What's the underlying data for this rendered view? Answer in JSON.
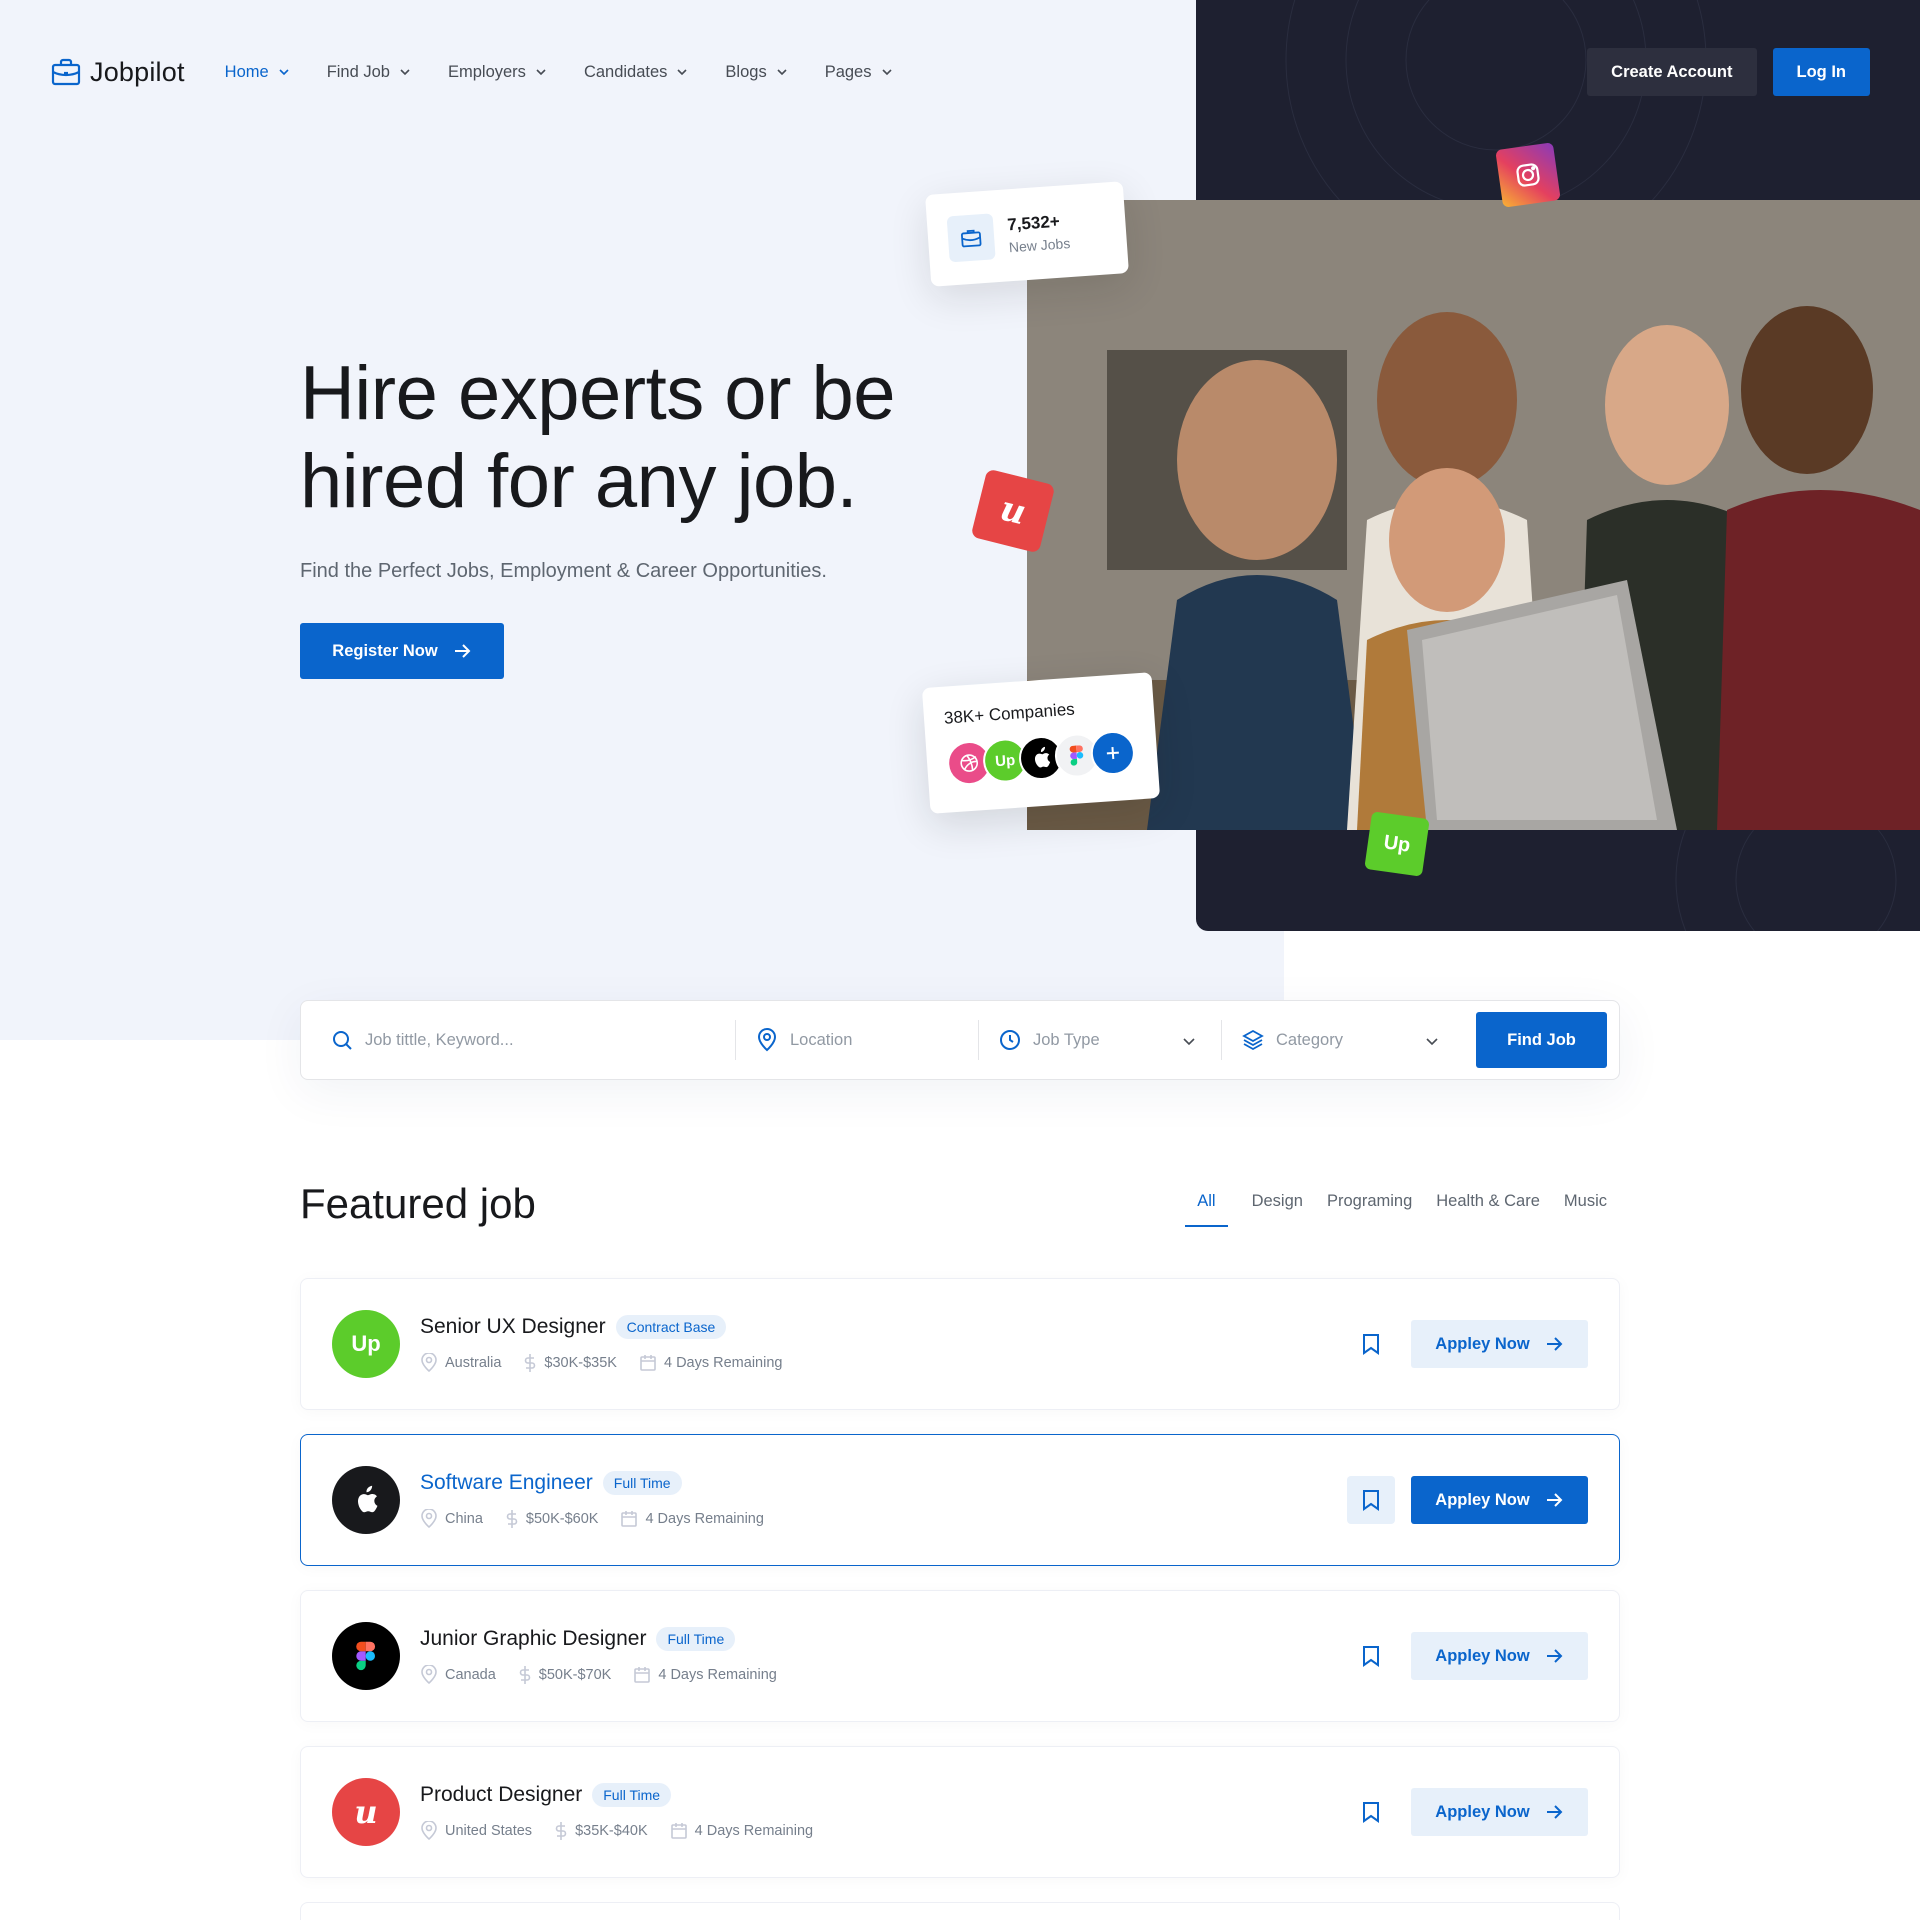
{
  "brand": {
    "name": "Jobpilot",
    "primary": "#0a65cc",
    "dark": "#1e2030"
  },
  "nav": {
    "items": [
      {
        "label": "Home",
        "active": true
      },
      {
        "label": "Find Job"
      },
      {
        "label": "Employers"
      },
      {
        "label": "Candidates"
      },
      {
        "label": "Blogs"
      },
      {
        "label": "Pages"
      }
    ],
    "create_account": "Create Account",
    "login": "Log In"
  },
  "hero": {
    "title_line1": "Hire experts or be",
    "title_line2": "hired for any job.",
    "subtitle": "Find the Perfect Jobs, Employment & Career Opportunities.",
    "register": "Register Now"
  },
  "stats": {
    "jobs_count": "7,532+",
    "jobs_label": "New Jobs",
    "companies": "38K+ Companies"
  },
  "search": {
    "keyword_placeholder": "Job tittle, Keyword...",
    "location_placeholder": "Location",
    "type_placeholder": "Job Type",
    "category_placeholder": "Category",
    "find": "Find Job"
  },
  "featured": {
    "title": "Featured job",
    "tabs": [
      "All",
      "Design",
      "Programing",
      "Health & Care",
      "Music"
    ],
    "active_tab": "All",
    "apply_label": "Appley Now",
    "jobs": [
      {
        "company_icon": "upwork-icon",
        "logo_color": "#5ccc2b",
        "title": "Senior UX Designer",
        "type": "Contract Base",
        "location": "Australia",
        "salary": "$30K-$35K",
        "remaining": "4 Days Remaining",
        "highlight": false
      },
      {
        "company_icon": "apple-icon",
        "logo_color": "#18191c",
        "title": "Software Engineer",
        "type": "Full Time",
        "location": "China",
        "salary": "$50K-$60K",
        "remaining": "4 Days Remaining",
        "highlight": true
      },
      {
        "company_icon": "figma-icon",
        "logo_color": "#000000",
        "title": "Junior Graphic Designer",
        "type": "Full Time",
        "location": "Canada",
        "salary": "$50K-$70K",
        "remaining": "4 Days Remaining",
        "highlight": false
      },
      {
        "company_icon": "udemy-icon",
        "logo_color": "#e64545",
        "title": "Product Designer",
        "type": "Full Time",
        "location": "United States",
        "salary": "$35K-$40K",
        "remaining": "4 Days Remaining",
        "highlight": false
      }
    ]
  }
}
